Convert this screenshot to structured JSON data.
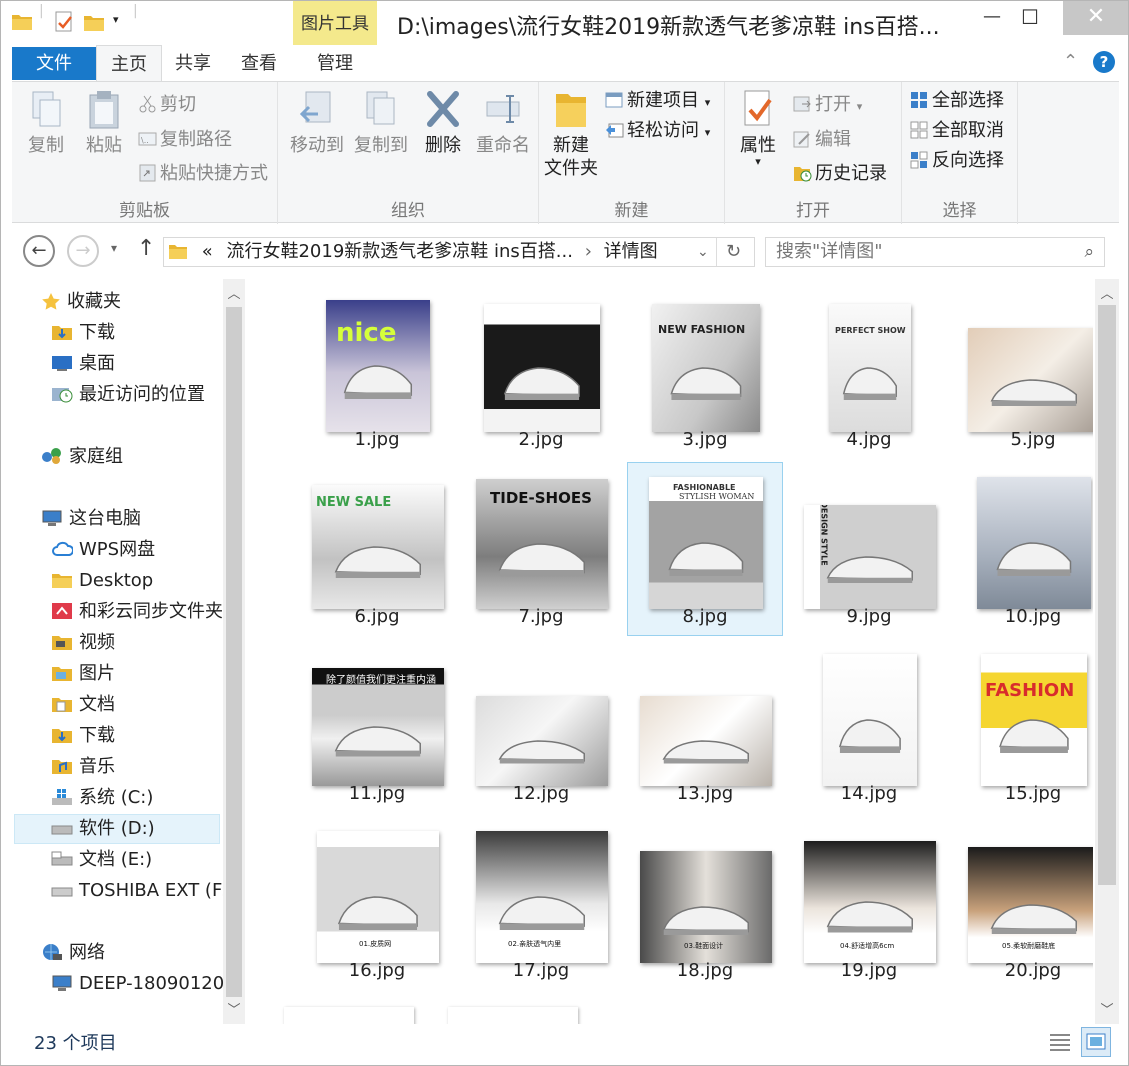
{
  "window": {
    "context_tab": "图片工具",
    "title": "D:\\images\\流行女鞋2019新款透气老爹凉鞋 ins百搭...",
    "minimize": "—",
    "maximize": "☐",
    "close": "✕"
  },
  "tabs": [
    {
      "label": "文件"
    },
    {
      "label": "主页"
    },
    {
      "label": "共享"
    },
    {
      "label": "查看"
    },
    {
      "label": "管理"
    }
  ],
  "ribbon": {
    "clipboard": {
      "label": "剪贴板",
      "copy": "复制",
      "paste": "粘贴",
      "cut": "剪切",
      "copy_path": "复制路径",
      "paste_shortcut": "粘贴快捷方式"
    },
    "organize": {
      "label": "组织",
      "move_to": "移动到",
      "copy_to": "复制到",
      "delete": "删除",
      "rename": "重命名"
    },
    "new": {
      "label": "新建",
      "new_folder_line1": "新建",
      "new_folder_line2": "文件夹",
      "new_item": "新建项目",
      "easy_access": "轻松访问"
    },
    "open": {
      "label": "打开",
      "properties": "属性",
      "open": "打开",
      "edit": "编辑",
      "history": "历史记录"
    },
    "select": {
      "label": "选择",
      "select_all": "全部选择",
      "select_none": "全部取消",
      "invert": "反向选择"
    }
  },
  "address": {
    "prefix": "«",
    "crumb1": "流行女鞋2019新款透气老爹凉鞋 ins百搭...",
    "sep": "›",
    "crumb2": "详情图",
    "search_placeholder": "搜索\"详情图\""
  },
  "nav": {
    "favorites": "收藏夹",
    "downloads_fav": "下载",
    "desktop_fav": "桌面",
    "recent": "最近访问的位置",
    "homegroup": "家庭组",
    "this_pc": "这台电脑",
    "wps": "WPS网盘",
    "desktop": "Desktop",
    "hecaiyun": "和彩云同步文件夹",
    "videos": "视频",
    "pictures": "图片",
    "documents": "文档",
    "downloads": "下载",
    "music": "音乐",
    "drive_c": "系统 (C:)",
    "drive_d": "软件 (D:)",
    "drive_e": "文档 (E:)",
    "drive_f": "TOSHIBA EXT (F:",
    "network": "网络",
    "deep": "DEEP-18090120"
  },
  "files": [
    {
      "name": "1.jpg"
    },
    {
      "name": "2.jpg"
    },
    {
      "name": "3.jpg"
    },
    {
      "name": "4.jpg"
    },
    {
      "name": "5.jpg"
    },
    {
      "name": "6.jpg"
    },
    {
      "name": "7.jpg"
    },
    {
      "name": "8.jpg"
    },
    {
      "name": "9.jpg"
    },
    {
      "name": "10.jpg"
    },
    {
      "name": "11.jpg"
    },
    {
      "name": "12.jpg"
    },
    {
      "name": "13.jpg"
    },
    {
      "name": "14.jpg"
    },
    {
      "name": "15.jpg"
    },
    {
      "name": "16.jpg"
    },
    {
      "name": "17.jpg"
    },
    {
      "name": "18.jpg"
    },
    {
      "name": "19.jpg"
    },
    {
      "name": "20.jpg"
    }
  ],
  "thumb_text": {
    "t1": "nice",
    "t3": "NEW FASHION",
    "t4": "PERFECT SHOW",
    "t6": "NEW SALE",
    "t7": "TIDE-SHOES",
    "t8a": "FASHIONABLE",
    "t8b": "STYLISH WOMAN",
    "t9": "DESIGN STYLE",
    "t11": "除了颜值我们更注重内涵",
    "t15": "FASHION",
    "t16": "01.皮质网",
    "t17": "02.亲肤透气内里",
    "t18": "03.鞋面设计",
    "t19": "04.舒适增高6cm",
    "t20": "05.柔软耐磨鞋底"
  },
  "status": {
    "count": "23 个项目"
  },
  "colors": {
    "accent": "#1979ca",
    "context": "#f4e98c",
    "selection": "#e5f3fb"
  }
}
